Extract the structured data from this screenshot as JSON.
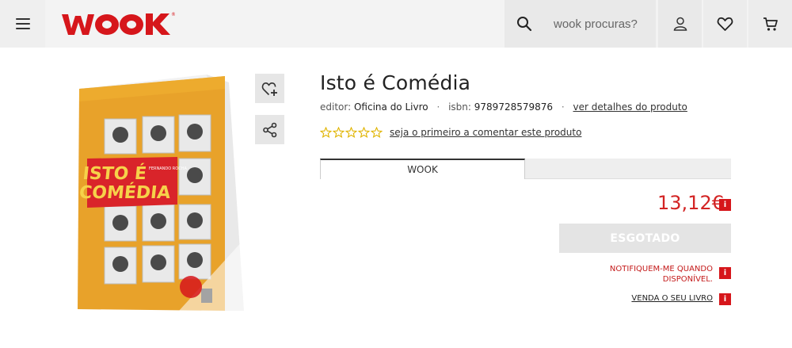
{
  "header": {
    "logo_text": "WOOK",
    "search_placeholder": "wook procuras?"
  },
  "colors": {
    "brand": "#d6161b",
    "price": "#d32424",
    "header_bg": "#f3f3f3"
  },
  "product": {
    "title": "Isto é Comédia",
    "editor_label": "editor:",
    "editor": "Oficina do Livro",
    "isbn_label": "isbn:",
    "isbn": "9789728579876",
    "details_link": "ver detalhes do produto",
    "rating_stars": 0,
    "rating_max": 5,
    "review_link": "seja o primeiro a comentar este produto",
    "cover": {
      "title_line1": "ISTO É",
      "title_line2": "COMÉDIA",
      "author": "FERNANDO ROCHA"
    }
  },
  "tabs": [
    {
      "label": "WOOK",
      "active": true
    },
    {
      "label": "",
      "active": false
    }
  ],
  "purchase": {
    "price": "13,12€",
    "info_icon": "i",
    "status_button": "ESGOTADO",
    "notify_line1": "NOTIFIQUEM-ME QUANDO",
    "notify_line2": "DISPONÍVEL.",
    "sell_link": "VENDA O SEU LIVRO"
  }
}
